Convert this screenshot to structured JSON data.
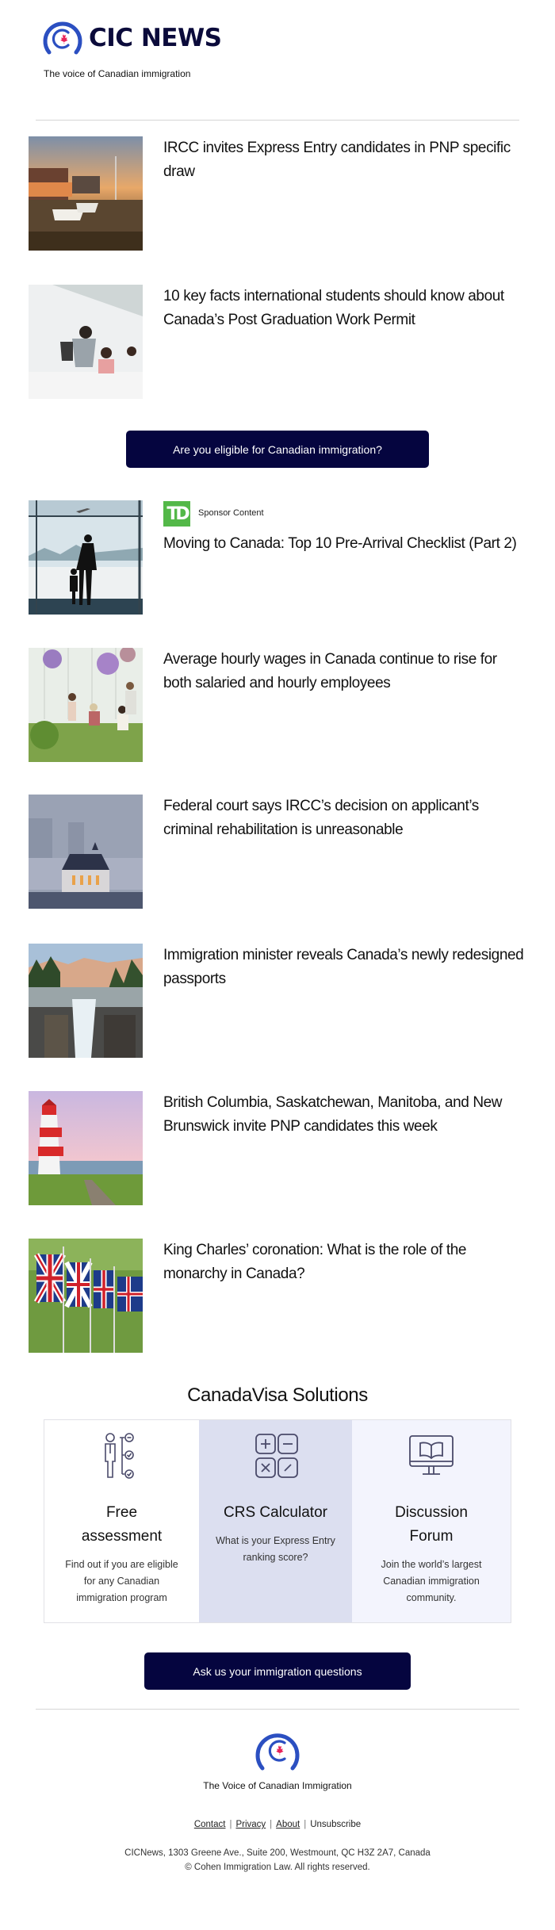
{
  "header": {
    "brand": "CIC NEWS",
    "tagline": "The voice of Canadian immigration",
    "logo_colors": {
      "ring": "#2b4fc1",
      "leaf": "#e8245a"
    }
  },
  "articles": [
    {
      "title": "IRCC invites Express Entry candidates in PNP specific draw",
      "image": "harbour-sunset-image"
    },
    {
      "title": "10 key facts international students should know about Canada’s Post Graduation Work Permit",
      "image": "students-image"
    },
    {
      "title": "Moving to Canada: Top 10 Pre-Arrival Checklist (Part 2)",
      "image": "airport-window-image",
      "sponsor": {
        "logo_text": "TD",
        "label": "Sponsor Content"
      }
    },
    {
      "title": "Average hourly wages in Canada continue to rise for both salaried and hourly employees",
      "image": "greenhouse-workers-image"
    },
    {
      "title": "Federal court says IRCC’s decision on applicant’s criminal rehabilitation is unreasonable",
      "image": "supreme-court-fog-image"
    },
    {
      "title": "Immigration minister reveals Canada’s newly redesigned passports",
      "image": "waterfall-canyon-image"
    },
    {
      "title": "British Columbia, Saskatchewan, Manitoba, and New Brunswick invite PNP candidates this week",
      "image": "lighthouse-image"
    },
    {
      "title": "King Charles’ coronation: What is the role of the monarchy in Canada?",
      "image": "union-jack-flags-image"
    }
  ],
  "cta_eligibility": "Are you eligible for Canadian immigration?",
  "solutions": {
    "title": "CanadaVisa Solutions",
    "items": [
      {
        "heading": "Free assessment",
        "description": "Find out if you are eligible for any Canadian immigration program",
        "icon": "assessment-checklist-icon",
        "bg": "#ffffff"
      },
      {
        "heading": "CRS Calculator",
        "description": "What is your Express Entry ranking score?",
        "icon": "calculator-icon",
        "bg": "#dcdff0"
      },
      {
        "heading": "Discussion Forum",
        "description": "Join the world’s largest Canadian immigration community.",
        "icon": "forum-monitor-book-icon",
        "bg": "#f3f4fd"
      }
    ]
  },
  "cta_questions": "Ask us your immigration questions",
  "footer": {
    "tagline": "The Voice of Canadian Immigration",
    "links": [
      "Contact",
      "Privacy",
      "About",
      "Unsubscribe"
    ],
    "address": "CICNews, 1303 Greene Ave., Suite 200, Westmount, QC H3Z 2A7, Canada",
    "copyright": "© Cohen Immigration Law. All rights reserved."
  },
  "colors": {
    "button_bg": "#05053f",
    "brand_text": "#0b0b3b",
    "td_green": "#53b848"
  }
}
